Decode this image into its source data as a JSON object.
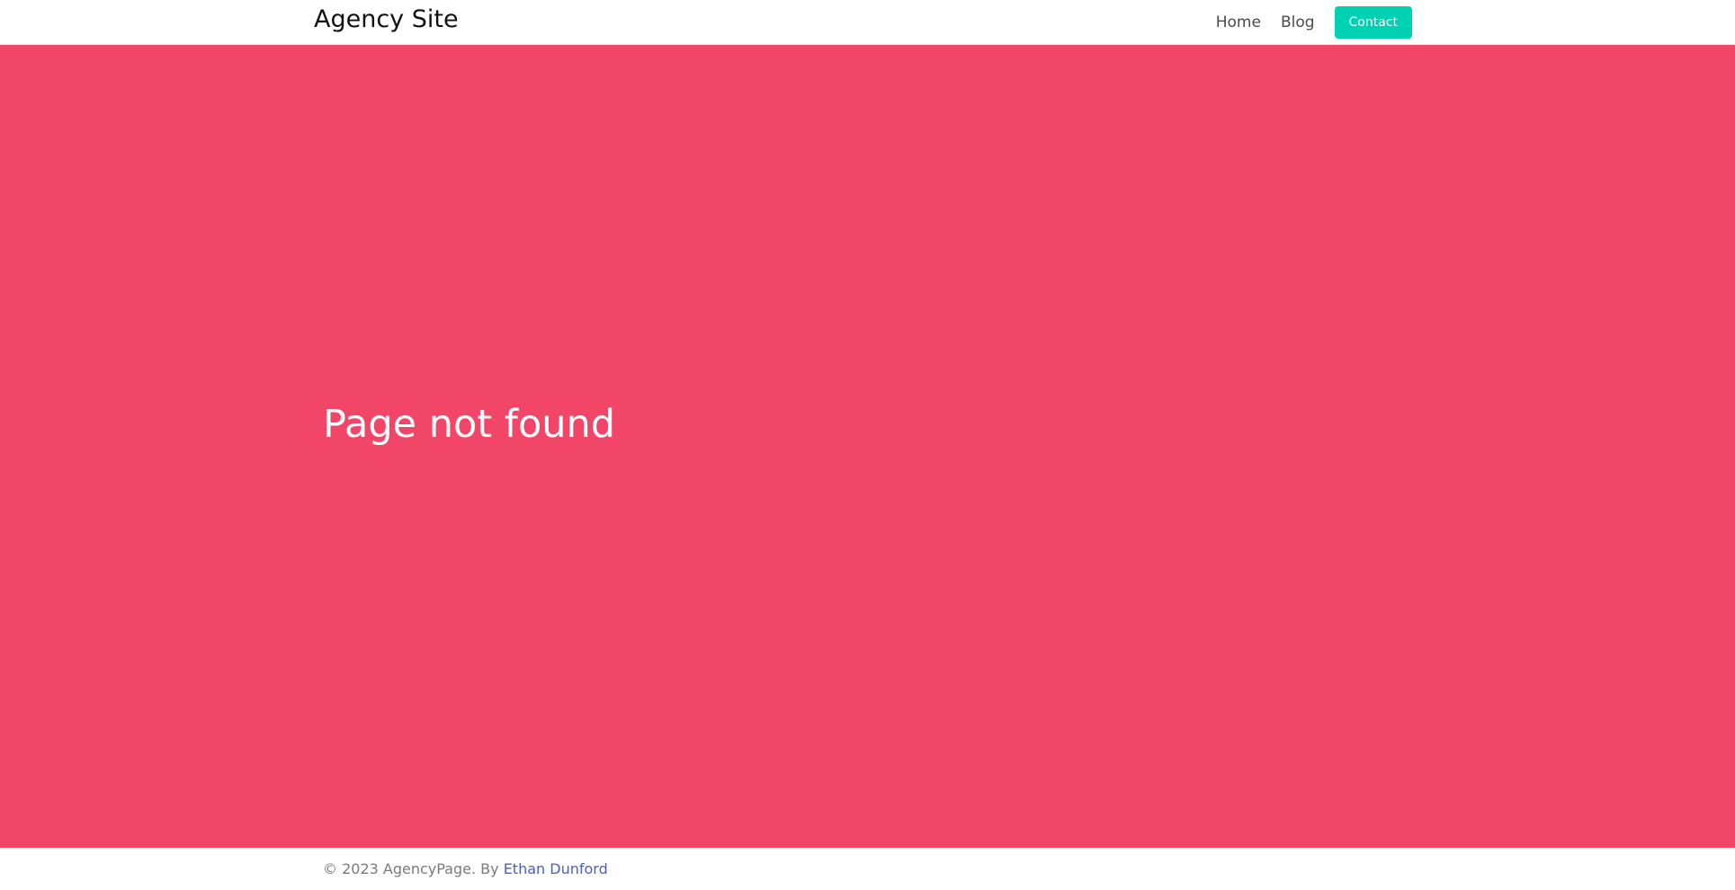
{
  "navbar": {
    "brand": "Agency Site",
    "links": [
      {
        "label": "Home"
      },
      {
        "label": "Blog"
      }
    ],
    "contact_label": "Contact"
  },
  "hero": {
    "title": "Page not found",
    "background_color": "#f14668"
  },
  "footer": {
    "copyright": "© 2023 AgencyPage. By",
    "author": "Ethan Dunford"
  },
  "colors": {
    "accent": "#00d1b2",
    "hero": "#f14668",
    "link": "#485fc7"
  }
}
